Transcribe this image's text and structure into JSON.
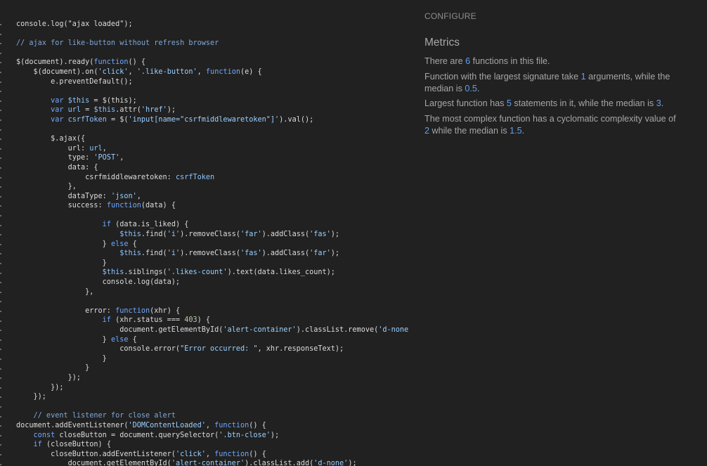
{
  "colors": {
    "background": "#212121",
    "accent_number": "#62a0ea"
  },
  "code_lines": [
    [
      [
        "plain",
        "console.log(\"ajax loaded\");"
      ]
    ],
    [],
    [
      [
        "com",
        "// ajax for like-button without refresh browser"
      ]
    ],
    [],
    [
      [
        "plain",
        "$(document).ready("
      ],
      [
        "kw",
        "function"
      ],
      [
        "plain",
        "() {"
      ]
    ],
    [
      [
        "plain",
        "    $(document).on("
      ],
      [
        "str",
        "'click'"
      ],
      [
        "plain",
        ", "
      ],
      [
        "str",
        "'.like-button'"
      ],
      [
        "plain",
        ", "
      ],
      [
        "kw",
        "function"
      ],
      [
        "plain",
        "(e) {"
      ]
    ],
    [
      [
        "plain",
        "        e.preventDefault();"
      ]
    ],
    [],
    [
      [
        "plain",
        "        "
      ],
      [
        "kw",
        "var"
      ],
      [
        "plain",
        " "
      ],
      [
        "var",
        "$this"
      ],
      [
        "plain",
        " = $(this);"
      ]
    ],
    [
      [
        "plain",
        "        "
      ],
      [
        "kw",
        "var"
      ],
      [
        "plain",
        " "
      ],
      [
        "var",
        "url"
      ],
      [
        "plain",
        " = "
      ],
      [
        "var",
        "$this"
      ],
      [
        "plain",
        ".attr("
      ],
      [
        "str",
        "'href'"
      ],
      [
        "plain",
        ");"
      ]
    ],
    [
      [
        "plain",
        "        "
      ],
      [
        "kw",
        "var"
      ],
      [
        "plain",
        " "
      ],
      [
        "var",
        "csrfToken"
      ],
      [
        "plain",
        " = $("
      ],
      [
        "str",
        "'input[name=\"csrfmiddlewaretoken\"]'"
      ],
      [
        "plain",
        ").val();"
      ]
    ],
    [],
    [
      [
        "plain",
        "        $.ajax({"
      ]
    ],
    [
      [
        "plain",
        "            url: "
      ],
      [
        "var",
        "url"
      ],
      [
        "plain",
        ","
      ]
    ],
    [
      [
        "plain",
        "            type: "
      ],
      [
        "str",
        "'POST'"
      ],
      [
        "plain",
        ","
      ]
    ],
    [
      [
        "plain",
        "            data: {"
      ]
    ],
    [
      [
        "plain",
        "                csrfmiddlewaretoken: "
      ],
      [
        "var",
        "csrfToken"
      ]
    ],
    [
      [
        "plain",
        "            },"
      ]
    ],
    [
      [
        "plain",
        "            dataType: "
      ],
      [
        "str",
        "'json'"
      ],
      [
        "plain",
        ","
      ]
    ],
    [
      [
        "plain",
        "            success: "
      ],
      [
        "kw",
        "function"
      ],
      [
        "plain",
        "(data) {"
      ]
    ],
    [],
    [
      [
        "plain",
        "                    "
      ],
      [
        "kw",
        "if"
      ],
      [
        "plain",
        " (data.is_liked) {"
      ]
    ],
    [
      [
        "plain",
        "                        "
      ],
      [
        "var",
        "$this"
      ],
      [
        "plain",
        ".find("
      ],
      [
        "str",
        "'i'"
      ],
      [
        "plain",
        ").removeClass("
      ],
      [
        "str",
        "'far'"
      ],
      [
        "plain",
        ").addClass("
      ],
      [
        "str",
        "'fas'"
      ],
      [
        "plain",
        ");"
      ]
    ],
    [
      [
        "plain",
        "                    } "
      ],
      [
        "kw",
        "else"
      ],
      [
        "plain",
        " {"
      ]
    ],
    [
      [
        "plain",
        "                        "
      ],
      [
        "var",
        "$this"
      ],
      [
        "plain",
        ".find("
      ],
      [
        "str",
        "'i'"
      ],
      [
        "plain",
        ").removeClass("
      ],
      [
        "str",
        "'fas'"
      ],
      [
        "plain",
        ").addClass("
      ],
      [
        "str",
        "'far'"
      ],
      [
        "plain",
        ");"
      ]
    ],
    [
      [
        "plain",
        "                    }"
      ]
    ],
    [
      [
        "plain",
        "                    "
      ],
      [
        "var",
        "$this"
      ],
      [
        "plain",
        ".siblings("
      ],
      [
        "str",
        "'.likes-count'"
      ],
      [
        "plain",
        ").text(data.likes_count);"
      ]
    ],
    [
      [
        "plain",
        "                    console.log(data);"
      ]
    ],
    [
      [
        "plain",
        "                },"
      ]
    ],
    [],
    [
      [
        "plain",
        "                error: "
      ],
      [
        "kw",
        "function"
      ],
      [
        "plain",
        "(xhr) {"
      ]
    ],
    [
      [
        "plain",
        "                    "
      ],
      [
        "kw",
        "if"
      ],
      [
        "plain",
        " (xhr.status === "
      ],
      [
        "num",
        "403"
      ],
      [
        "plain",
        ") {"
      ]
    ],
    [
      [
        "plain",
        "                        document.getElementById("
      ],
      [
        "str",
        "'alert-container'"
      ],
      [
        "plain",
        ").classList.remove("
      ],
      [
        "str",
        "'d-none"
      ]
    ],
    [
      [
        "plain",
        "                    } "
      ],
      [
        "kw",
        "else"
      ],
      [
        "plain",
        " {"
      ]
    ],
    [
      [
        "plain",
        "                        console.error("
      ],
      [
        "str",
        "\"Error occurred: \""
      ],
      [
        "plain",
        ", xhr.responseText);"
      ]
    ],
    [
      [
        "plain",
        "                    }"
      ]
    ],
    [
      [
        "plain",
        "                }"
      ]
    ],
    [
      [
        "plain",
        "            });"
      ]
    ],
    [
      [
        "plain",
        "        });"
      ]
    ],
    [
      [
        "plain",
        "    });"
      ]
    ],
    [],
    [
      [
        "com",
        "    // event listener for close alert"
      ]
    ],
    [
      [
        "plain",
        "document.addEventListener("
      ],
      [
        "str",
        "'DOMContentLoaded'"
      ],
      [
        "plain",
        ", "
      ],
      [
        "kw",
        "function"
      ],
      [
        "plain",
        "() {"
      ]
    ],
    [
      [
        "plain",
        "    "
      ],
      [
        "kw",
        "const"
      ],
      [
        "plain",
        " closeButton = document.querySelector("
      ],
      [
        "str",
        "'.btn-close'"
      ],
      [
        "plain",
        ");"
      ]
    ],
    [
      [
        "plain",
        "    "
      ],
      [
        "kw",
        "if"
      ],
      [
        "plain",
        " (closeButton) {"
      ]
    ],
    [
      [
        "plain",
        "        closeButton.addEventListener("
      ],
      [
        "str",
        "'click'"
      ],
      [
        "plain",
        ", "
      ],
      [
        "kw",
        "function"
      ],
      [
        "plain",
        "() {"
      ]
    ],
    [
      [
        "plain",
        "            document.getElementById("
      ],
      [
        "str",
        "'alert-container'"
      ],
      [
        "plain",
        ").classList.add("
      ],
      [
        "str",
        "'d-none'"
      ],
      [
        "plain",
        ");"
      ]
    ]
  ],
  "panel": {
    "configure_label": "CONFIGURE",
    "metrics_title": "Metrics",
    "m1": {
      "a": "There are ",
      "n": "6",
      "b": " functions in this file."
    },
    "m2": {
      "a": "Function with the largest signature take ",
      "n": "1",
      "b": " arguments, while the median is ",
      "n2": "0.5",
      "c": "."
    },
    "m3": {
      "a": "Largest function has ",
      "n": "5",
      "b": " statements in it, while the median is ",
      "n2": "3",
      "c": "."
    },
    "m4": {
      "a": "The most complex function has a cyclomatic complexity value of ",
      "n": "2",
      "b": " while the median is ",
      "n2": "1.5",
      "c": "."
    }
  }
}
